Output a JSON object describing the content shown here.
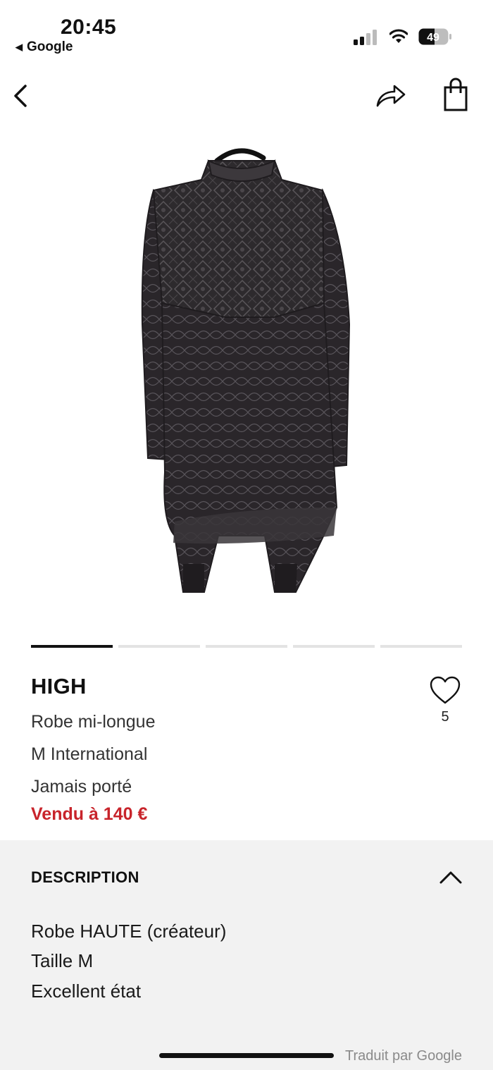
{
  "status_bar": {
    "time": "20:45",
    "back_app": "Google",
    "battery": "49"
  },
  "nav": {
    "back_icon": "chevron-left-icon",
    "share_icon": "share-arrow-icon",
    "bag_icon": "shopping-bag-icon"
  },
  "gallery": {
    "total_images": 5,
    "active_index": 0
  },
  "product": {
    "brand": "HIGH",
    "type": "Robe mi-longue",
    "size": "M International",
    "condition": "Jamais porté",
    "price": "Vendu à 140 €",
    "likes": "5"
  },
  "description": {
    "title": "DESCRIPTION",
    "lines": [
      "Robe HAUTE (créateur)",
      "Taille M",
      "Excellent état"
    ],
    "translated": "Traduit par Google"
  },
  "colors": {
    "price_red": "#c8242b",
    "section_bg": "#f2f2f2"
  }
}
